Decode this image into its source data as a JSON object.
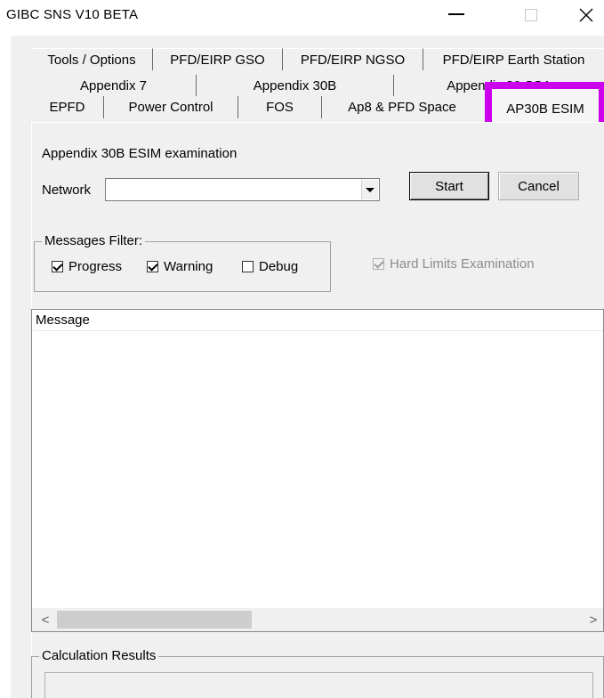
{
  "window": {
    "title": "GIBC SNS V10 BETA",
    "controls": {
      "minimize": "—",
      "maximize": "□",
      "close": "✕"
    }
  },
  "tabs": {
    "row1": [
      "Tools / Options",
      "PFD/EIRP GSO",
      "PFD/EIRP NGSO",
      "PFD/EIRP Earth Station"
    ],
    "row2": [
      "Appendix 7",
      "Appendix 30B",
      "Appendix 30 SSA"
    ],
    "row3": [
      "EPFD",
      "Power Control",
      "FOS",
      "Ap8 & PFD Space"
    ],
    "selected": "AP30B ESIM",
    "selected_highlight_color": "#cc00ee"
  },
  "examination": {
    "heading": "Appendix 30B ESIM examination",
    "network_label": "Network",
    "network_value": "",
    "start_label": "Start",
    "cancel_label": "Cancel"
  },
  "filter": {
    "title": "Messages Filter:",
    "progress_label": "Progress",
    "progress_checked": true,
    "warning_label": "Warning",
    "warning_checked": true,
    "debug_label": "Debug",
    "debug_checked": false
  },
  "hard_limits": {
    "label": "Hard Limits Examination",
    "checked": true,
    "enabled": false
  },
  "messages": {
    "column_header": "Message",
    "rows": [],
    "scroll_left": "<",
    "scroll_right": ">"
  },
  "results": {
    "title": "Calculation Results"
  }
}
